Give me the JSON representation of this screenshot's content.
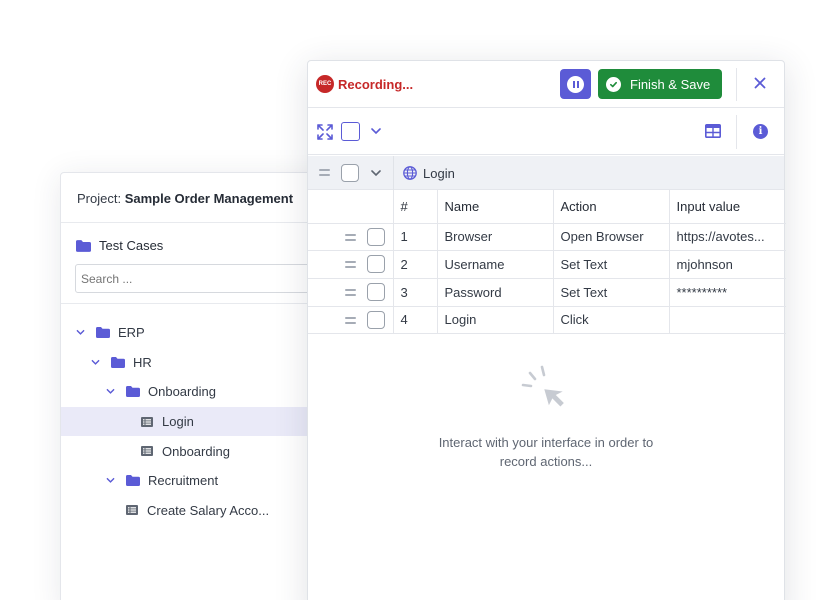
{
  "project": {
    "label": "Project:",
    "name": "Sample Order Management",
    "test_cases_title": "Test Cases",
    "search_placeholder": "Search ...",
    "tree": [
      {
        "label": "ERP",
        "type": "folder",
        "level": 0,
        "expanded": true,
        "selected": false
      },
      {
        "label": "HR",
        "type": "folder",
        "level": 1,
        "expanded": true,
        "selected": false
      },
      {
        "label": "Onboarding",
        "type": "folder",
        "level": 2,
        "expanded": true,
        "selected": false
      },
      {
        "label": "Login",
        "type": "test",
        "level": 3,
        "selected": true
      },
      {
        "label": "Onboarding",
        "type": "test",
        "level": 3,
        "selected": false
      },
      {
        "label": "Recruitment",
        "type": "folder",
        "level": 2,
        "expanded": true,
        "selected": false
      },
      {
        "label": "Create Salary Acco...",
        "type": "test",
        "level": 2,
        "selected": false
      }
    ]
  },
  "recorder": {
    "badge": "REC",
    "status": "Recording...",
    "finish_label": "Finish & Save",
    "group_label": "Login",
    "columns": [
      "#",
      "Name",
      "Action",
      "Input value"
    ],
    "steps": [
      {
        "num": "1",
        "name": "Browser",
        "action": "Open Browser",
        "input": "https://avotes..."
      },
      {
        "num": "2",
        "name": "Username",
        "action": "Set Text",
        "input": "mjohnson"
      },
      {
        "num": "3",
        "name": "Password",
        "action": "Set Text",
        "input": "**********"
      },
      {
        "num": "4",
        "name": "Login",
        "action": "Click",
        "input": ""
      }
    ],
    "empty_line1": "Interact with your interface in order to",
    "empty_line2": "record actions..."
  },
  "colors": {
    "accent": "#5b5bd6",
    "recording_red": "#c62828",
    "finish_green": "#1f8c3b",
    "selected_row": "#eaeaf8"
  },
  "icons": [
    "folder-icon",
    "test-case-icon",
    "chevron-down-icon",
    "pause-icon",
    "check-circle-icon",
    "close-icon",
    "expand-icon",
    "table-view-icon",
    "info-icon",
    "drag-handle-icon",
    "globe-icon",
    "cursor-click-icon"
  ]
}
